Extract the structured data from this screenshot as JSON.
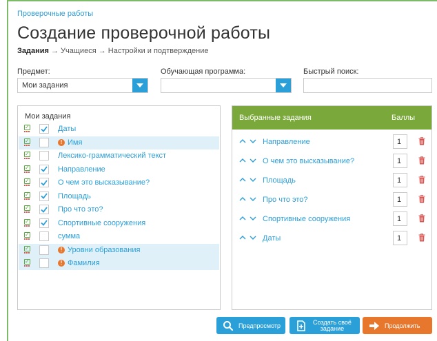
{
  "breadcrumb": "Проверочные работы",
  "page_title": "Создание проверочной работы",
  "steps": {
    "current": "Задания",
    "sep1": " → Учащиеся → ",
    "settings": "Настройки и подтверждение"
  },
  "filters": {
    "subject_label": "Предмет:",
    "subject_value": "Мои задания",
    "program_label": "Обучающая программа:",
    "program_value": "",
    "search_label": "Быстрый поиск:",
    "search_value": ""
  },
  "left_panel": {
    "title": "Мои задания",
    "items": [
      {
        "label": "Даты",
        "checked": true,
        "warning": false,
        "highlight": false
      },
      {
        "label": "Имя",
        "checked": false,
        "warning": true,
        "highlight": true
      },
      {
        "label": "Лексико-грамматический текст",
        "checked": false,
        "warning": false,
        "highlight": false
      },
      {
        "label": "Направление",
        "checked": true,
        "warning": false,
        "highlight": false
      },
      {
        "label": "О чем это высказывание?",
        "checked": true,
        "warning": false,
        "highlight": false
      },
      {
        "label": "Площадь",
        "checked": true,
        "warning": false,
        "highlight": false
      },
      {
        "label": "Про что это?",
        "checked": true,
        "warning": false,
        "highlight": false
      },
      {
        "label": "Спортивные сооружения",
        "checked": true,
        "warning": false,
        "highlight": false
      },
      {
        "label": "сумма",
        "checked": false,
        "warning": false,
        "highlight": false
      },
      {
        "label": "Уровни образования",
        "checked": false,
        "warning": true,
        "highlight": true
      },
      {
        "label": "Фамилия",
        "checked": false,
        "warning": true,
        "highlight": true
      }
    ]
  },
  "right_panel": {
    "header": "Выбранные задания",
    "score_header": "Баллы",
    "items": [
      {
        "label": "Направление",
        "score": "1"
      },
      {
        "label": "О чем это высказывание?",
        "score": "1"
      },
      {
        "label": "Площадь",
        "score": "1"
      },
      {
        "label": "Про что это?",
        "score": "1"
      },
      {
        "label": "Спортивные сооружения",
        "score": "1"
      },
      {
        "label": "Даты",
        "score": "1"
      }
    ]
  },
  "buttons": {
    "preview": "Предпросмотр",
    "create_line1": "Создать своё",
    "create_line2": "задание",
    "next": "Продолжить"
  },
  "colors": {
    "accent": "#2b9fd8",
    "header_green": "#7aa83a",
    "orange": "#e8772e",
    "trash": "#d9534f"
  }
}
